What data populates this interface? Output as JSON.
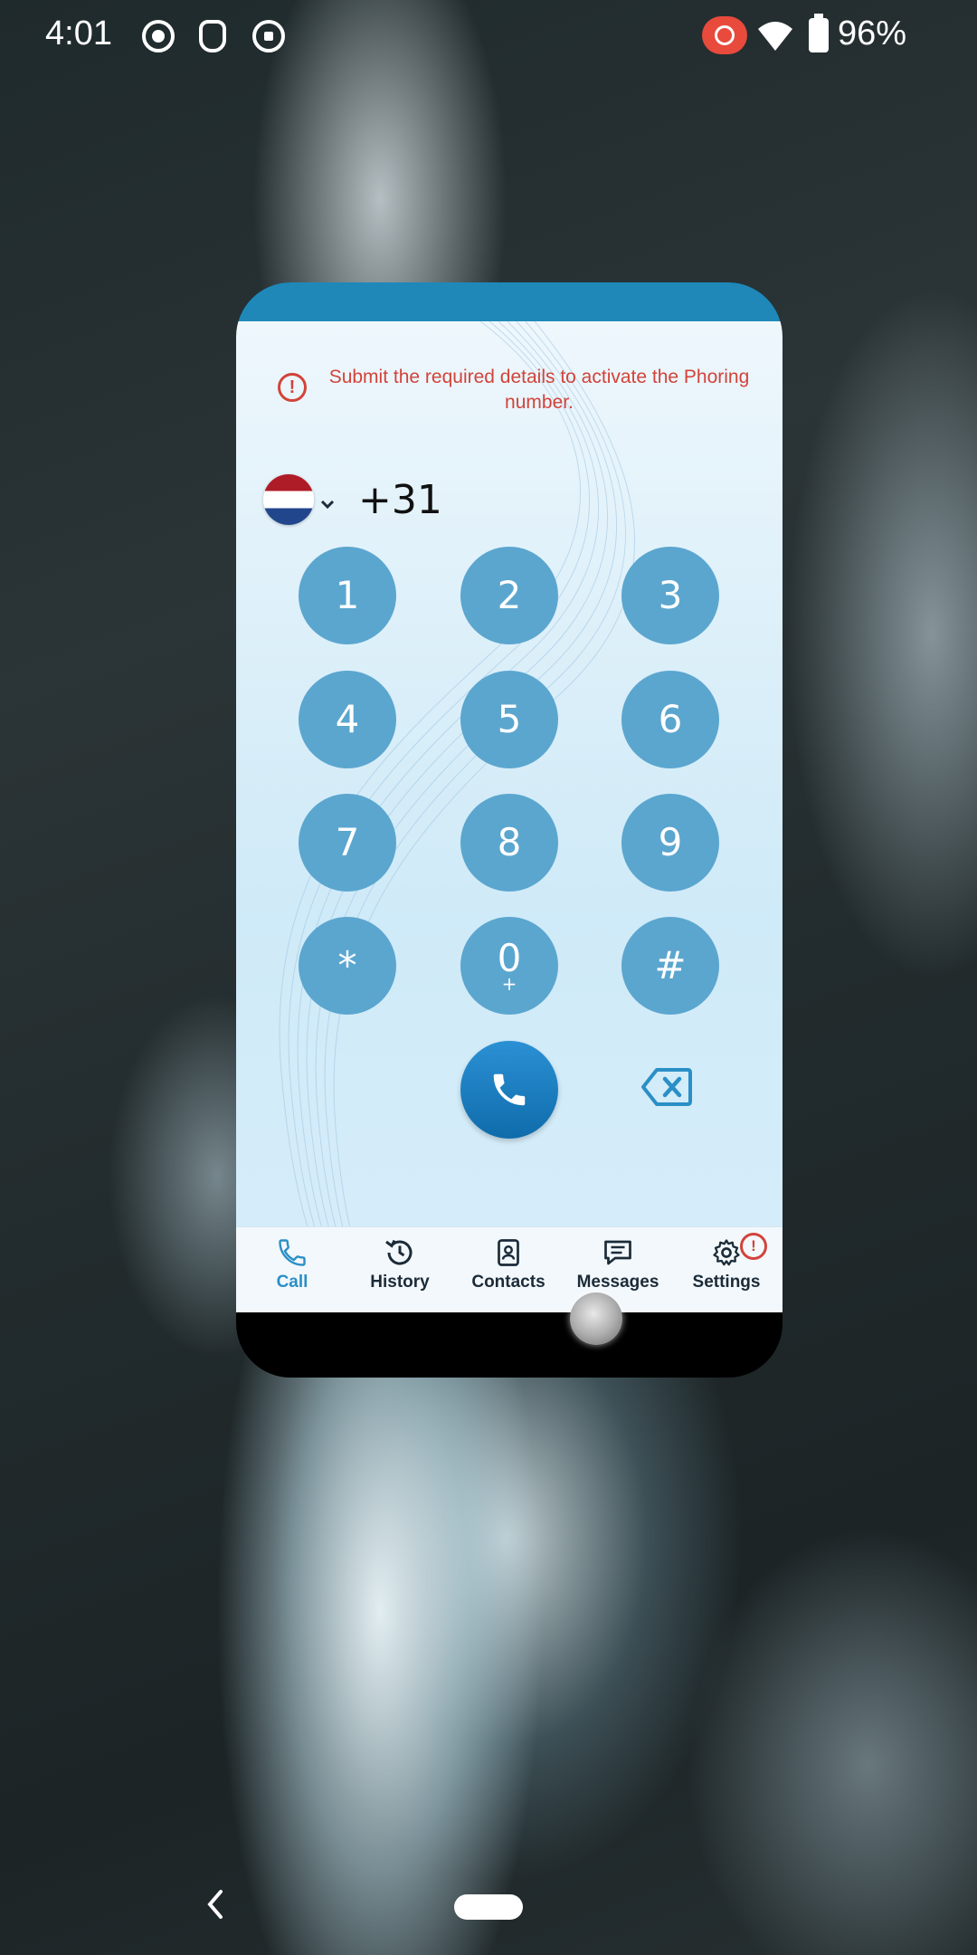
{
  "status_bar": {
    "time": "4:01",
    "battery": "96%"
  },
  "app": {
    "alert_message": "Submit the required details to activate the Phoring number.",
    "alert_icon": "!",
    "country_code": "+31",
    "keypad": [
      {
        "main": "1",
        "sub": ""
      },
      {
        "main": "2",
        "sub": ""
      },
      {
        "main": "3",
        "sub": ""
      },
      {
        "main": "4",
        "sub": ""
      },
      {
        "main": "5",
        "sub": ""
      },
      {
        "main": "6",
        "sub": ""
      },
      {
        "main": "7",
        "sub": ""
      },
      {
        "main": "8",
        "sub": ""
      },
      {
        "main": "9",
        "sub": ""
      },
      {
        "main": "*",
        "sub": ""
      },
      {
        "main": "0",
        "sub": "+"
      },
      {
        "main": "#",
        "sub": ""
      }
    ],
    "nav": {
      "call": "Call",
      "history": "History",
      "contacts": "Contacts",
      "messages": "Messages",
      "settings": "Settings",
      "settings_badge": "!"
    }
  },
  "colors": {
    "accent": "#2a8fc6",
    "key": "#5ba6cf",
    "alert": "#d2433a",
    "topbar": "#1f88b8"
  },
  "icons": {
    "status": [
      "screen-record-icon",
      "assistant-icon",
      "notification-icon",
      "record-icon",
      "wifi-icon",
      "battery-charging-icon"
    ],
    "nav": [
      "phone-icon",
      "history-icon",
      "contacts-icon",
      "messages-icon",
      "settings-icon"
    ]
  }
}
